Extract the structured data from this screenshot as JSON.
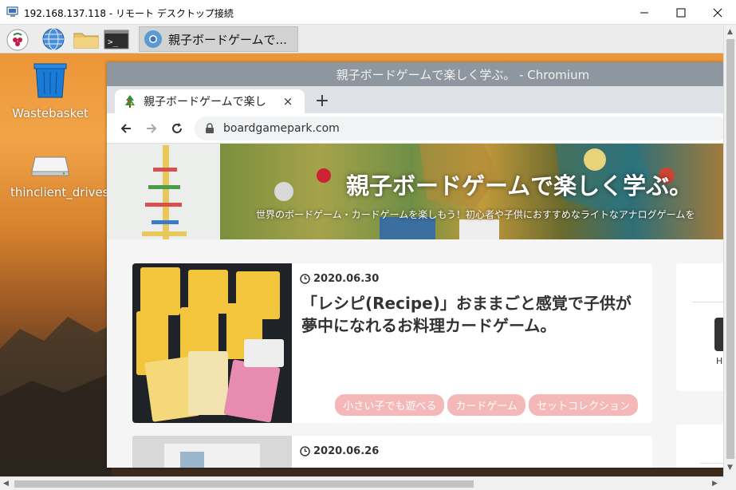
{
  "rdp_window": {
    "title": "192.168.137.118 - リモート デスクトップ接続",
    "buttons": {
      "minimize": "minimize",
      "maximize": "maximize",
      "close": "close"
    }
  },
  "taskbar": {
    "launchers": [
      "raspberry-menu",
      "web-browser",
      "file-manager",
      "terminal"
    ],
    "active_task": "親子ボードゲームで..."
  },
  "desktop": {
    "icons": [
      {
        "label": "Wastebasket",
        "icon": "trash-icon"
      },
      {
        "label": "thinclient_drives",
        "icon": "drive-icon"
      }
    ]
  },
  "browser": {
    "window_title": "親子ボードゲームで楽しく学ぶ。 - Chromium",
    "tab_title": "親子ボードゲームで楽し",
    "tab_close": "×",
    "new_tab": "+",
    "url": "boardgamepark.com"
  },
  "page": {
    "hero_title": "親子ボードゲームで楽しく学ぶ。",
    "hero_subtitle": "世界のボードゲーム・カードゲームを楽しもう！初心者や子供におすすめなライトなアナログゲームを",
    "posts": [
      {
        "date": "2020.06.30",
        "title": "「レシピ(Recipe)」おままごと感覚で子供が夢中になれるお料理カードゲーム。",
        "tags": [
          "小さい子でも遊べる",
          "カードゲーム",
          "セットコレクション"
        ]
      },
      {
        "date": "2020.06.26"
      }
    ],
    "sidebar_snippet": "H"
  },
  "colors": {
    "accent_tag": "#f4b8b8",
    "chromium_title": "#8e969f",
    "desktop_orange": "#e99133"
  }
}
